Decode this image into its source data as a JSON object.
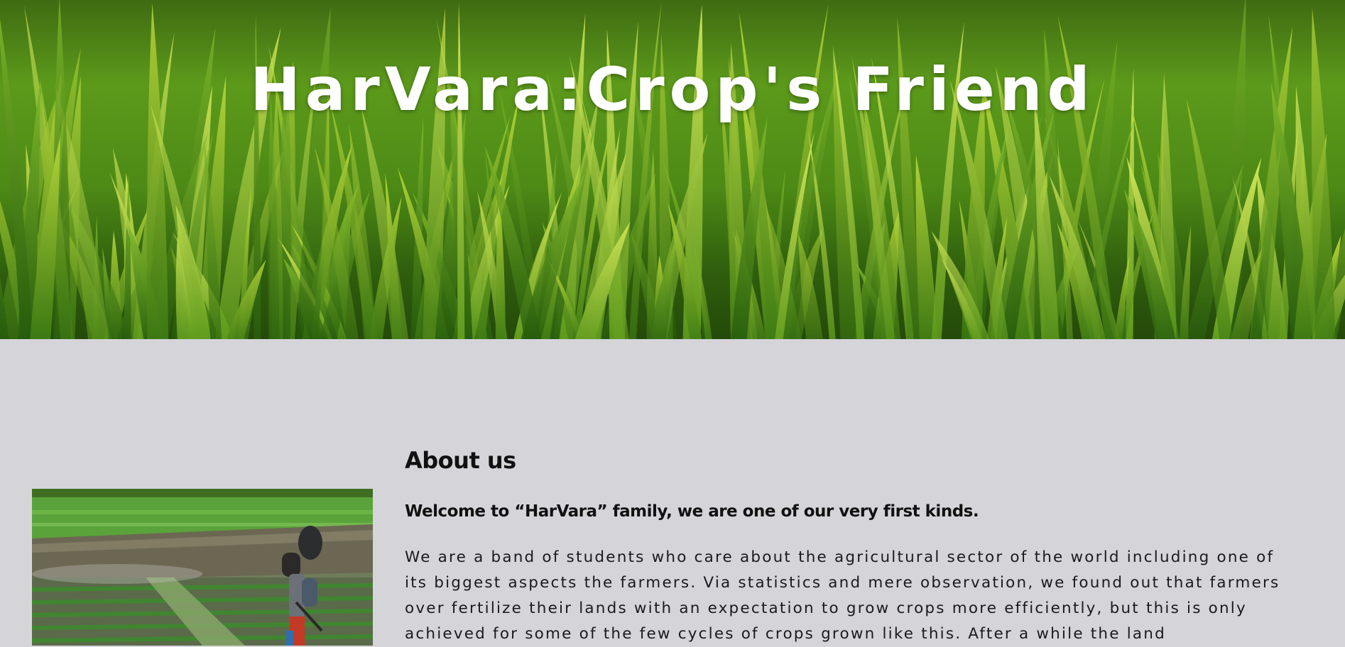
{
  "hero": {
    "title": "HarVara:Crop's Friend",
    "image": "corn-field-photo"
  },
  "about": {
    "heading": "About us",
    "subheading": "Welcome to “HarVara” family, we are one of our very first kinds.",
    "body": "We are a band of students who care about the agricultural sector of the world including one of its biggest aspects the farmers. Via statistics and mere observation, we found out that farmers over fertilize their lands with an expectation to grow crops more efficiently, but this is only achieved for some of the few cycles of crops grown like this. After a while the land",
    "image": "farmer-spraying-field-photo"
  },
  "colors": {
    "page_background": "#d5d4d9",
    "hero_title": "#ffffff",
    "text": "#111111"
  }
}
